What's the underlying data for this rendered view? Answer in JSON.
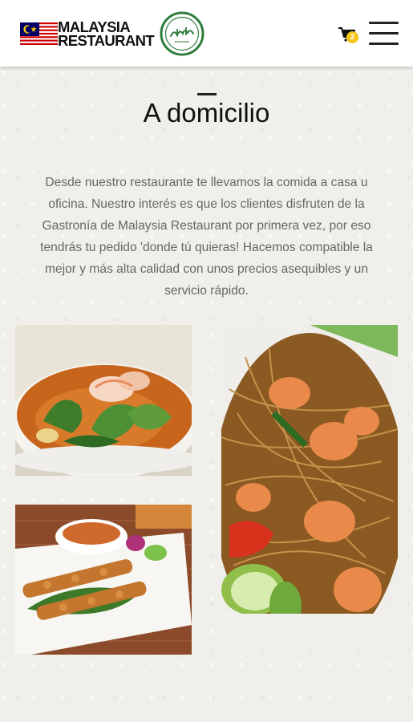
{
  "header": {
    "brand_line1": "MALAYSIA",
    "brand_line2": "RESTAURANT",
    "logo_icon": "malaysia-flag-icon",
    "halal_icon": "halal-badge-icon",
    "cart_icon": "cart-icon",
    "cart_count": "2",
    "menu_icon": "hamburger-menu-icon"
  },
  "main": {
    "title": "A domicilio",
    "intro": "Desde nuestro restaurante te llevamos la comida a casa u oficina. Nuestro interés es que los clientes disfruten de la Gastronía de Malaysia Restaurant por primera vez, por eso tendrás tu pedido 'donde tú quieras! Hacemos compatible la mejor y más alta calidad con unos precios asequibles y un servicio rápido."
  },
  "colors": {
    "background": "#f1efea",
    "header_bg": "#ffffff",
    "badge": "#f5c518",
    "halal_green": "#2f7d3b",
    "text": "#666666"
  }
}
